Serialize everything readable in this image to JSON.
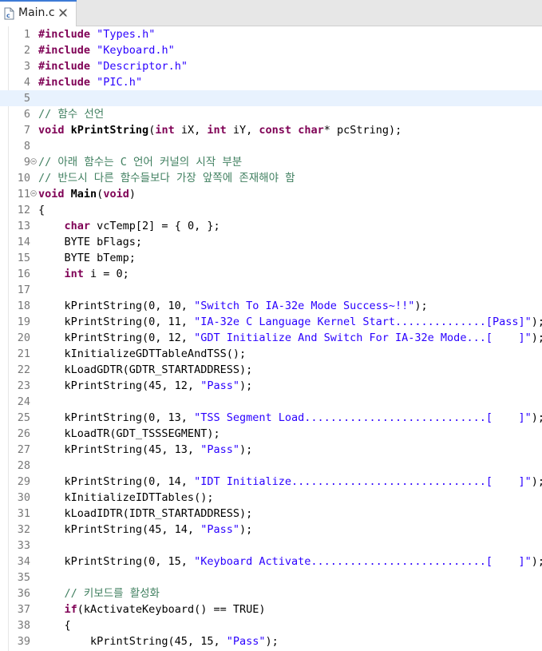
{
  "tab": {
    "title": "Main.c",
    "icon": "c-source-file-icon",
    "close_icon": "close-icon"
  },
  "colors": {
    "keyword": "#7f0055",
    "string": "#2a00ff",
    "comment": "#3f7f5f",
    "line_number": "#787878",
    "current_line": "#e8f2fe",
    "tab_accent": "#3d7bd6"
  },
  "current_line": 5,
  "folded_lines": [
    9,
    11
  ],
  "lines": [
    [
      [
        "kw",
        "#include"
      ],
      [
        "t",
        " "
      ],
      [
        "str",
        "\"Types.h\""
      ]
    ],
    [
      [
        "kw",
        "#include"
      ],
      [
        "t",
        " "
      ],
      [
        "str",
        "\"Keyboard.h\""
      ]
    ],
    [
      [
        "kw",
        "#include"
      ],
      [
        "t",
        " "
      ],
      [
        "str",
        "\"Descriptor.h\""
      ]
    ],
    [
      [
        "kw",
        "#include"
      ],
      [
        "t",
        " "
      ],
      [
        "str",
        "\"PIC.h\""
      ]
    ],
    [],
    [
      [
        "cmt",
        "// 함수 선언"
      ]
    ],
    [
      [
        "kw",
        "void"
      ],
      [
        "t",
        " "
      ],
      [
        "fn",
        "kPrintString"
      ],
      [
        "t",
        "("
      ],
      [
        "kw",
        "int"
      ],
      [
        "t",
        " iX, "
      ],
      [
        "kw",
        "int"
      ],
      [
        "t",
        " iY, "
      ],
      [
        "kw",
        "const"
      ],
      [
        "t",
        " "
      ],
      [
        "kw",
        "char"
      ],
      [
        "t",
        "* pcString);"
      ]
    ],
    [],
    [
      [
        "cmt",
        "// 아래 함수는 C 언어 커널의 시작 부분"
      ]
    ],
    [
      [
        "cmt",
        "// 반드시 다른 함수들보다 가장 앞쪽에 존재해야 함"
      ]
    ],
    [
      [
        "kw",
        "void"
      ],
      [
        "t",
        " "
      ],
      [
        "fn",
        "Main"
      ],
      [
        "t",
        "("
      ],
      [
        "kw",
        "void"
      ],
      [
        "t",
        ")"
      ]
    ],
    [
      [
        "t",
        "{"
      ]
    ],
    [
      [
        "t",
        "    "
      ],
      [
        "kw",
        "char"
      ],
      [
        "t",
        " vcTemp[2] = { 0, };"
      ]
    ],
    [
      [
        "t",
        "    BYTE bFlags;"
      ]
    ],
    [
      [
        "t",
        "    BYTE bTemp;"
      ]
    ],
    [
      [
        "t",
        "    "
      ],
      [
        "kw",
        "int"
      ],
      [
        "t",
        " i = 0;"
      ]
    ],
    [],
    [
      [
        "t",
        "    kPrintString(0, 10, "
      ],
      [
        "str",
        "\"Switch To IA-32e Mode Success~!!\""
      ],
      [
        "t",
        ");"
      ]
    ],
    [
      [
        "t",
        "    kPrintString(0, 11, "
      ],
      [
        "str",
        "\"IA-32e C Language Kernel Start..............[Pass]\""
      ],
      [
        "t",
        ");"
      ]
    ],
    [
      [
        "t",
        "    kPrintString(0, 12, "
      ],
      [
        "str",
        "\"GDT Initialize And Switch For IA-32e Mode...[    ]\""
      ],
      [
        "t",
        ");"
      ]
    ],
    [
      [
        "t",
        "    kInitializeGDTTableAndTSS();"
      ]
    ],
    [
      [
        "t",
        "    kLoadGDTR(GDTR_STARTADDRESS);"
      ]
    ],
    [
      [
        "t",
        "    kPrintString(45, 12, "
      ],
      [
        "str",
        "\"Pass\""
      ],
      [
        "t",
        ");"
      ]
    ],
    [],
    [
      [
        "t",
        "    kPrintString(0, 13, "
      ],
      [
        "str",
        "\"TSS Segment Load............................[    ]\""
      ],
      [
        "t",
        ");"
      ]
    ],
    [
      [
        "t",
        "    kLoadTR(GDT_TSSSEGMENT);"
      ]
    ],
    [
      [
        "t",
        "    kPrintString(45, 13, "
      ],
      [
        "str",
        "\"Pass\""
      ],
      [
        "t",
        ");"
      ]
    ],
    [],
    [
      [
        "t",
        "    kPrintString(0, 14, "
      ],
      [
        "str",
        "\"IDT Initialize..............................[    ]\""
      ],
      [
        "t",
        ");"
      ]
    ],
    [
      [
        "t",
        "    kInitializeIDTTables();"
      ]
    ],
    [
      [
        "t",
        "    kLoadIDTR(IDTR_STARTADDRESS);"
      ]
    ],
    [
      [
        "t",
        "    kPrintString(45, 14, "
      ],
      [
        "str",
        "\"Pass\""
      ],
      [
        "t",
        ");"
      ]
    ],
    [],
    [
      [
        "t",
        "    kPrintString(0, 15, "
      ],
      [
        "str",
        "\"Keyboard Activate...........................[    ]\""
      ],
      [
        "t",
        ");"
      ]
    ],
    [],
    [
      [
        "t",
        "    "
      ],
      [
        "cmt",
        "// 키보드를 활성화"
      ]
    ],
    [
      [
        "t",
        "    "
      ],
      [
        "kw",
        "if"
      ],
      [
        "t",
        "(kActivateKeyboard() == TRUE)"
      ]
    ],
    [
      [
        "t",
        "    {"
      ]
    ],
    [
      [
        "t",
        "        kPrintString(45, 15, "
      ],
      [
        "str",
        "\"Pass\""
      ],
      [
        "t",
        ");"
      ]
    ]
  ]
}
